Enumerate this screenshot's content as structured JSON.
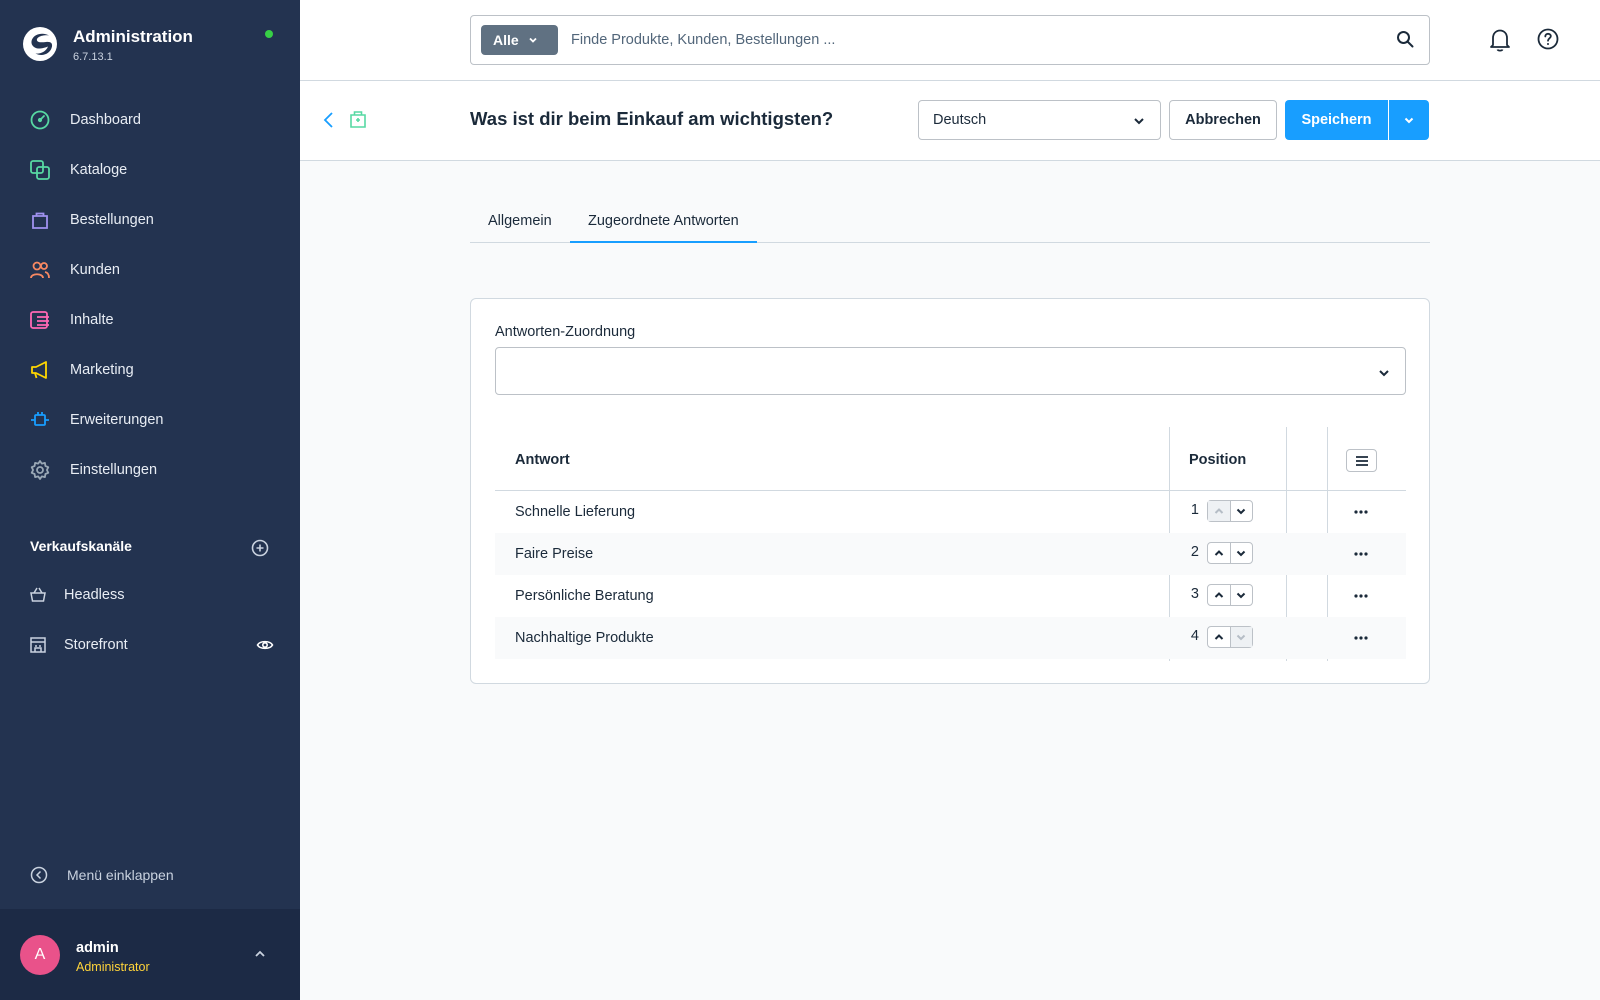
{
  "app": {
    "title": "Administration",
    "version": "6.7.13.1"
  },
  "sidebar": {
    "items": [
      {
        "label": "Dashboard",
        "icon": "dashboard-icon",
        "color": "#57d9a3"
      },
      {
        "label": "Kataloge",
        "icon": "catalog-icon",
        "color": "#57d9a3"
      },
      {
        "label": "Bestellungen",
        "icon": "orders-icon",
        "color": "#a092f0"
      },
      {
        "label": "Kunden",
        "icon": "customers-icon",
        "color": "#f88962"
      },
      {
        "label": "Inhalte",
        "icon": "content-icon",
        "color": "#ff68b4"
      },
      {
        "label": "Marketing",
        "icon": "marketing-icon",
        "color": "#ffd700"
      },
      {
        "label": "Erweiterungen",
        "icon": "extensions-icon",
        "color": "#189eff"
      },
      {
        "label": "Einstellungen",
        "icon": "settings-icon",
        "color": "#9aa8b5"
      }
    ],
    "sales_channels_title": "Verkaufskanäle",
    "channels": [
      {
        "label": "Headless"
      },
      {
        "label": "Storefront"
      }
    ],
    "collapse_label": "Menü einklappen",
    "user": {
      "initial": "A",
      "name": "admin",
      "role": "Administrator"
    }
  },
  "topbar": {
    "search_type": "Alle",
    "search_placeholder": "Finde Produkte, Kunden, Bestellungen ..."
  },
  "smartbar": {
    "title": "Was ist dir beim Einkauf am wichtigsten?",
    "language": "Deutsch",
    "cancel_label": "Abbrechen",
    "save_label": "Speichern"
  },
  "tabs": [
    {
      "label": "Allgemein",
      "active": false
    },
    {
      "label": "Zugeordnete Antworten",
      "active": true
    }
  ],
  "card": {
    "field_label": "Antworten-Zuordnung",
    "field_value": "",
    "columns": {
      "answer": "Antwort",
      "position": "Position"
    },
    "rows": [
      {
        "answer": "Schnelle Lieferung",
        "position": "1"
      },
      {
        "answer": "Faire Preise",
        "position": "2"
      },
      {
        "answer": "Persönliche Beratung",
        "position": "3"
      },
      {
        "answer": "Nachhaltige Produkte",
        "position": "4"
      }
    ]
  },
  "colors": {
    "sidebar_bg": "#233350",
    "primary": "#189eff",
    "status_online": "#37d046",
    "avatar": "#e9528a",
    "user_role": "#ffd43a"
  }
}
